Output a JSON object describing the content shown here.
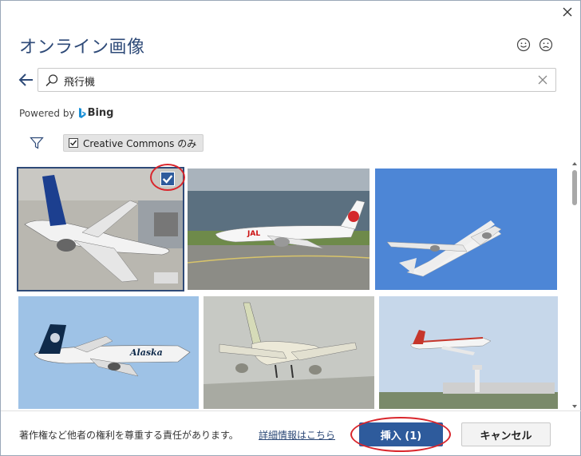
{
  "dialog": {
    "title": "オンライン画像",
    "close_icon": "close-icon",
    "feedback_icons": [
      "smile-face-icon",
      "frown-face-icon"
    ]
  },
  "search": {
    "value": "飛行機",
    "back_icon": "back-arrow-icon",
    "search_icon": "search-icon",
    "clear_icon": "clear-x-icon"
  },
  "powered": {
    "prefix": "Powered by",
    "brand": "Bing"
  },
  "filters": {
    "filter_icon": "filter-funnel-icon",
    "creative_commons_label": "Creative Commons のみ",
    "creative_commons_checked": true
  },
  "images": [
    {
      "subject": "ANA airliner at gate",
      "selected": true
    },
    {
      "subject": "JAL airliner taxiing",
      "selected": false
    },
    {
      "subject": "airliner in blue sky",
      "selected": false
    },
    {
      "subject": "Alaska airliner in flight",
      "selected": false
    },
    {
      "subject": "airliner landing gear down",
      "selected": false
    },
    {
      "subject": "red-white airliner over airport",
      "selected": false
    }
  ],
  "colors": {
    "accent": "#2e5b9c",
    "title": "#2e4a78",
    "highlight_ring": "#d9262c"
  },
  "footer": {
    "notice": "著作権など他者の権利を尊重する責任があります。",
    "link": "詳細情報はこちら",
    "insert_label": "挿入 (1)",
    "cancel_label": "キャンセル"
  }
}
